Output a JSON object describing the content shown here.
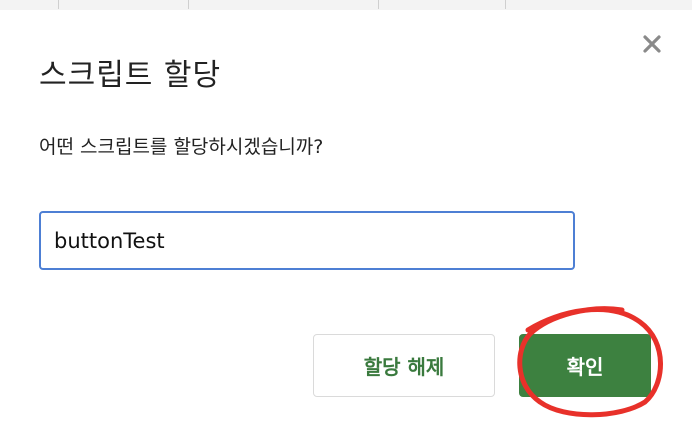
{
  "dialog": {
    "title": "스크립트 할당",
    "prompt": "어떤 스크립트를 할당하시겠습니까?",
    "script_input": {
      "value": "buttonTest",
      "placeholder": ""
    },
    "buttons": {
      "unassign_label": "할당 해제",
      "ok_label": "확인"
    },
    "close_icon": "close-icon"
  },
  "colors": {
    "primary": "#3d8140",
    "primary_text_secondary": "#3a7a3e",
    "input_focus_border": "#4d7fd4",
    "annotation": "#e8312a"
  }
}
